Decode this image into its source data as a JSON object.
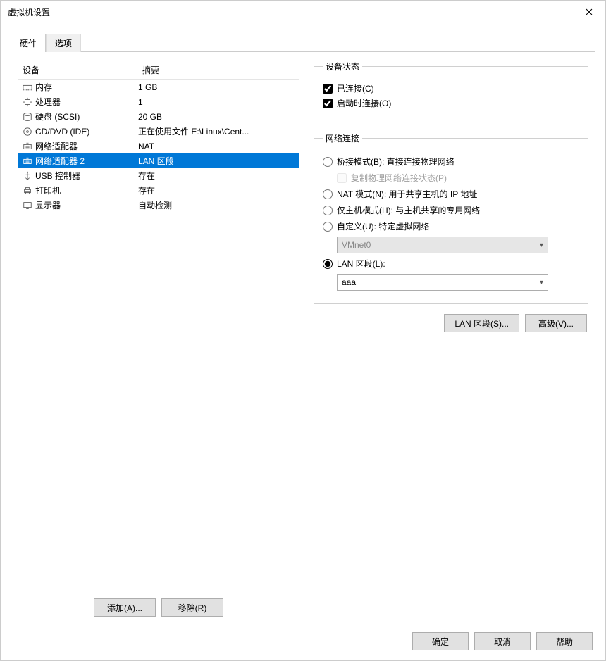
{
  "window": {
    "title": "虚拟机设置"
  },
  "tabs": {
    "hardware": "硬件",
    "options": "选项"
  },
  "table": {
    "head_device": "设备",
    "head_summary": "摘要",
    "rows": [
      {
        "icon": "memory",
        "name": "内存",
        "summary": "1 GB"
      },
      {
        "icon": "cpu",
        "name": "处理器",
        "summary": "1"
      },
      {
        "icon": "disk",
        "name": "硬盘 (SCSI)",
        "summary": "20 GB"
      },
      {
        "icon": "cd",
        "name": "CD/DVD (IDE)",
        "summary": "正在使用文件 E:\\Linux\\Cent..."
      },
      {
        "icon": "net",
        "name": "网络适配器",
        "summary": "NAT"
      },
      {
        "icon": "net",
        "name": "网络适配器 2",
        "summary": "LAN 区段",
        "selected": true
      },
      {
        "icon": "usb",
        "name": "USB 控制器",
        "summary": "存在"
      },
      {
        "icon": "printer",
        "name": "打印机",
        "summary": "存在"
      },
      {
        "icon": "display",
        "name": "显示器",
        "summary": "自动检测"
      }
    ]
  },
  "left_buttons": {
    "add": "添加(A)...",
    "remove": "移除(R)"
  },
  "status": {
    "legend": "设备状态",
    "connected": "已连接(C)",
    "connect_at_power_on": "启动时连接(O)"
  },
  "netconn": {
    "legend": "网络连接",
    "bridged": "桥接模式(B): 直接连接物理网络",
    "replicate": "复制物理网络连接状态(P)",
    "nat": "NAT 模式(N): 用于共享主机的 IP 地址",
    "hostonly": "仅主机模式(H): 与主机共享的专用网络",
    "custom": "自定义(U): 特定虚拟网络",
    "custom_value": "VMnet0",
    "lan": "LAN 区段(L):",
    "lan_value": "aaa"
  },
  "right_buttons": {
    "lanseg": "LAN 区段(S)...",
    "advanced": "高级(V)..."
  },
  "footer": {
    "ok": "确定",
    "cancel": "取消",
    "help": "帮助"
  }
}
